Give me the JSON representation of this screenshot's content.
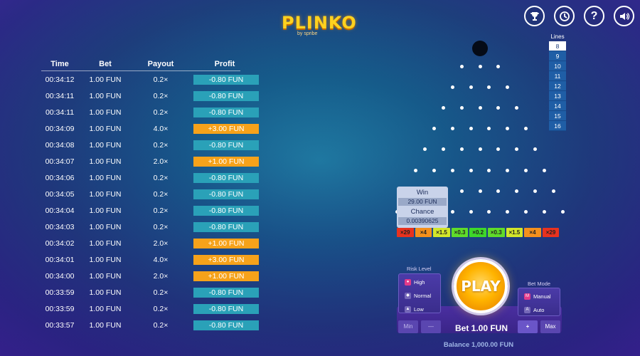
{
  "logo": {
    "title": "PLINKO",
    "subtitle": "by spribe"
  },
  "top_icons": [
    "trophy-icon",
    "history-icon",
    "help-icon",
    "sound-icon"
  ],
  "history": {
    "columns": [
      "Time",
      "Bet",
      "Payout",
      "Profit"
    ],
    "rows": [
      {
        "time": "00:34:12",
        "bet": "1.00 FUN",
        "payout": "0.2×",
        "profit": "-0.80 FUN",
        "win": false
      },
      {
        "time": "00:34:11",
        "bet": "1.00 FUN",
        "payout": "0.2×",
        "profit": "-0.80 FUN",
        "win": false
      },
      {
        "time": "00:34:11",
        "bet": "1.00 FUN",
        "payout": "0.2×",
        "profit": "-0.80 FUN",
        "win": false
      },
      {
        "time": "00:34:09",
        "bet": "1.00 FUN",
        "payout": "4.0×",
        "profit": "+3.00 FUN",
        "win": true
      },
      {
        "time": "00:34:08",
        "bet": "1.00 FUN",
        "payout": "0.2×",
        "profit": "-0.80 FUN",
        "win": false
      },
      {
        "time": "00:34:07",
        "bet": "1.00 FUN",
        "payout": "2.0×",
        "profit": "+1.00 FUN",
        "win": true
      },
      {
        "time": "00:34:06",
        "bet": "1.00 FUN",
        "payout": "0.2×",
        "profit": "-0.80 FUN",
        "win": false
      },
      {
        "time": "00:34:05",
        "bet": "1.00 FUN",
        "payout": "0.2×",
        "profit": "-0.80 FUN",
        "win": false
      },
      {
        "time": "00:34:04",
        "bet": "1.00 FUN",
        "payout": "0.2×",
        "profit": "-0.80 FUN",
        "win": false
      },
      {
        "time": "00:34:03",
        "bet": "1.00 FUN",
        "payout": "0.2×",
        "profit": "-0.80 FUN",
        "win": false
      },
      {
        "time": "00:34:02",
        "bet": "1.00 FUN",
        "payout": "2.0×",
        "profit": "+1.00 FUN",
        "win": true
      },
      {
        "time": "00:34:01",
        "bet": "1.00 FUN",
        "payout": "4.0×",
        "profit": "+3.00 FUN",
        "win": true
      },
      {
        "time": "00:34:00",
        "bet": "1.00 FUN",
        "payout": "2.0×",
        "profit": "+1.00 FUN",
        "win": true
      },
      {
        "time": "00:33:59",
        "bet": "1.00 FUN",
        "payout": "0.2×",
        "profit": "-0.80 FUN",
        "win": false
      },
      {
        "time": "00:33:59",
        "bet": "1.00 FUN",
        "payout": "0.2×",
        "profit": "-0.80 FUN",
        "win": false
      },
      {
        "time": "00:33:57",
        "bet": "1.00 FUN",
        "payout": "0.2×",
        "profit": "-0.80 FUN",
        "win": false
      }
    ]
  },
  "lines": {
    "label": "Lines",
    "options": [
      "8",
      "9",
      "10",
      "11",
      "12",
      "13",
      "14",
      "15",
      "16"
    ],
    "selected": "8"
  },
  "board": {
    "rows": 8
  },
  "tooltip": {
    "win_label": "Win",
    "win_value": "29.00 FUN",
    "chance_label": "Chance",
    "chance_value": "0.00390625"
  },
  "multipliers": [
    {
      "label": "×29",
      "color": "#e8321e"
    },
    {
      "label": "×4",
      "color": "#f4901c"
    },
    {
      "label": "×1.5",
      "color": "#d2e62a"
    },
    {
      "label": "×0.3",
      "color": "#5fdc2a"
    },
    {
      "label": "×0.2",
      "color": "#3ed82a"
    },
    {
      "label": "×0.3",
      "color": "#5fdc2a"
    },
    {
      "label": "×1.5",
      "color": "#d2e62a"
    },
    {
      "label": "×4",
      "color": "#f4901c"
    },
    {
      "label": "×29",
      "color": "#e8321e"
    }
  ],
  "controls": {
    "risk_title": "Risk Level",
    "risk_options": [
      "High",
      "Normal",
      "Low"
    ],
    "risk_selected": "High",
    "mode_title": "Bet Mode",
    "mode_options": [
      "Manual",
      "Auto"
    ],
    "mode_selected": "Manual",
    "play_label": "PLAY",
    "min_label": "Min",
    "minus_label": "—",
    "bet_label": "Bet 1.00 FUN",
    "plus_label": "+",
    "max_label": "Max"
  },
  "balance": "Balance 1,000.00 FUN"
}
